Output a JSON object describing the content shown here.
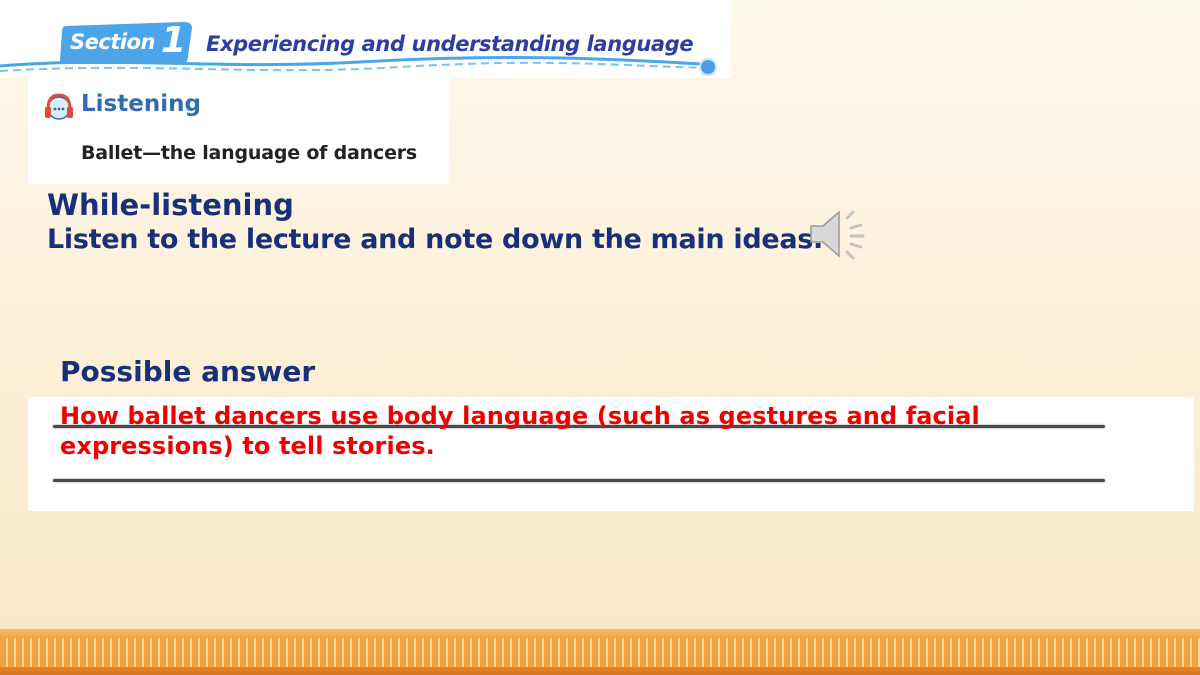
{
  "header": {
    "section_label": "Section",
    "section_number": "1",
    "title": "Experiencing and understanding language",
    "badge_color": "#4aa6e8",
    "title_color": "#2b3ea1"
  },
  "listening_card": {
    "icon": "headphones-icon",
    "label": "Listening",
    "subtitle": "Ballet—the language of dancers"
  },
  "main": {
    "stage_title": "While-listening",
    "instruction": "Listen to the lecture and note down the main ideas.",
    "audio_icon": "speaker-icon"
  },
  "answer": {
    "title": "Possible answer",
    "text": "How ballet dancers use body language (such as gestures and facial expressions) to tell stories.",
    "text_color": "#ee0000"
  },
  "colors": {
    "heading": "#18307a",
    "bottom_border": "#f0a040"
  }
}
